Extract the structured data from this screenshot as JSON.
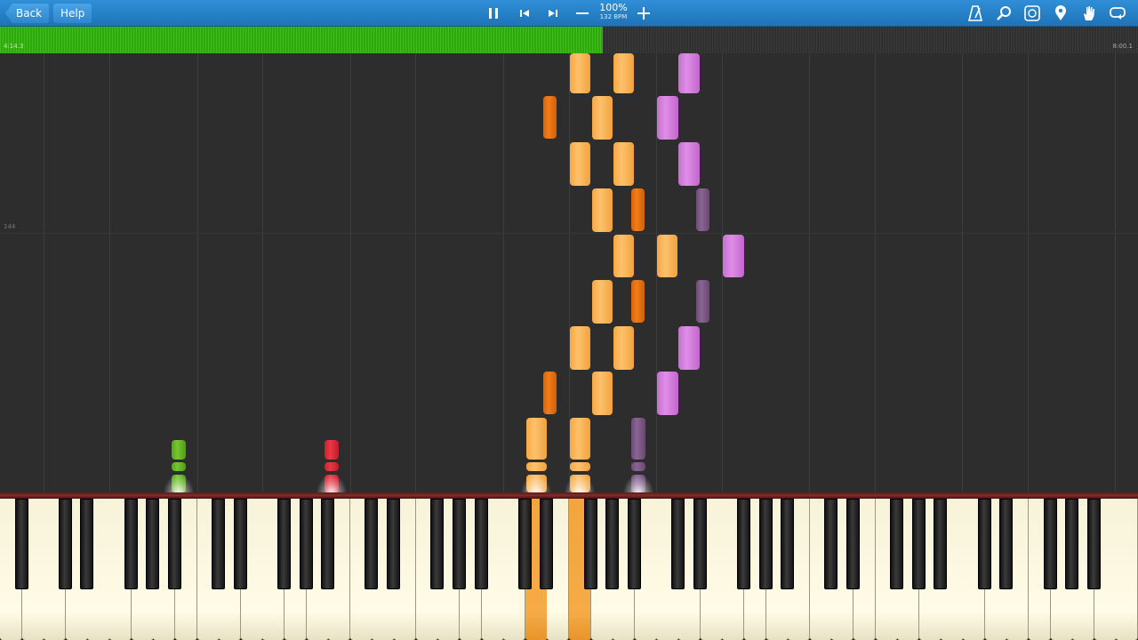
{
  "toolbar": {
    "back_label": "Back",
    "help_label": "Help",
    "speed_percent": "100%",
    "tempo_label": "132 BPM",
    "icons": [
      "pause-icon",
      "skip-back-icon",
      "skip-forward-icon",
      "minus-icon",
      "plus-icon",
      "metronome-icon",
      "search-icon",
      "label-icon",
      "map-pin-icon",
      "hand-icon",
      "loop-icon"
    ]
  },
  "progress": {
    "fraction": 0.53,
    "current_time": "4:14.3",
    "total_time": "8:00.1"
  },
  "notearea": {
    "measure_label": "144"
  },
  "colors": {
    "light_orange": "#fcc16d",
    "dark_orange": "#ef7d18",
    "light_purple": "#de8ee6",
    "dark_purple": "#8a6594",
    "green": "#76c630",
    "red": "#e83a46",
    "toolbar": "#2f8fd6",
    "progress": "#3fbf1a"
  }
}
